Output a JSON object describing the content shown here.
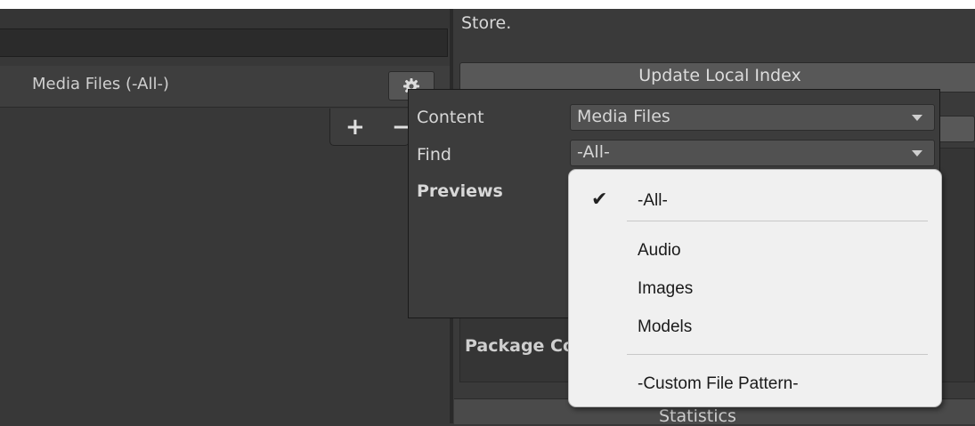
{
  "store_text": "Store.",
  "update_button": "Update Local Index",
  "list_header": "Media Files (-All-)",
  "gear": "gear-icon",
  "plus": "+",
  "minus": "−",
  "popup": {
    "content_label": "Content",
    "content_value": "Media Files",
    "find_label": "Find",
    "find_value": "-All-",
    "previews_label": "Previews"
  },
  "menu": {
    "items": [
      "-All-",
      "Audio",
      "Images",
      "Models",
      "-Custom File Pattern-"
    ],
    "selected": "-All-",
    "checkmark": "✔"
  },
  "package_label": "Package Conte",
  "statistics_label": "Statistics"
}
